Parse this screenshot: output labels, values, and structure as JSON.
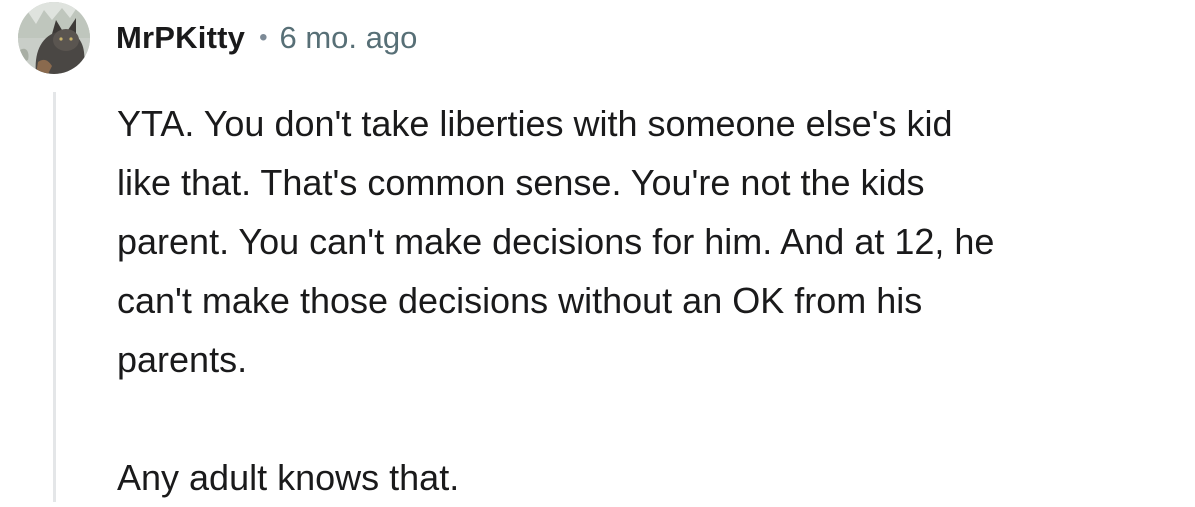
{
  "comment": {
    "author": "MrPKitty",
    "separator": "•",
    "time_ago": "6 mo. ago",
    "paragraphs": [
      "YTA. You don't take liberties with someone else's kid\nlike that. That's common sense. You're not the kids\nparent. You can't make decisions for him. And at 12, he\ncan't make those decisions without an OK from his\nparents.",
      "Any adult knows that."
    ]
  },
  "colors": {
    "author": "#1a1a1b",
    "meta": "#576f76",
    "thread_line": "#e4e6e8",
    "text": "#1a1a1b"
  },
  "icons": {
    "avatar": "cat-photo-avatar"
  }
}
